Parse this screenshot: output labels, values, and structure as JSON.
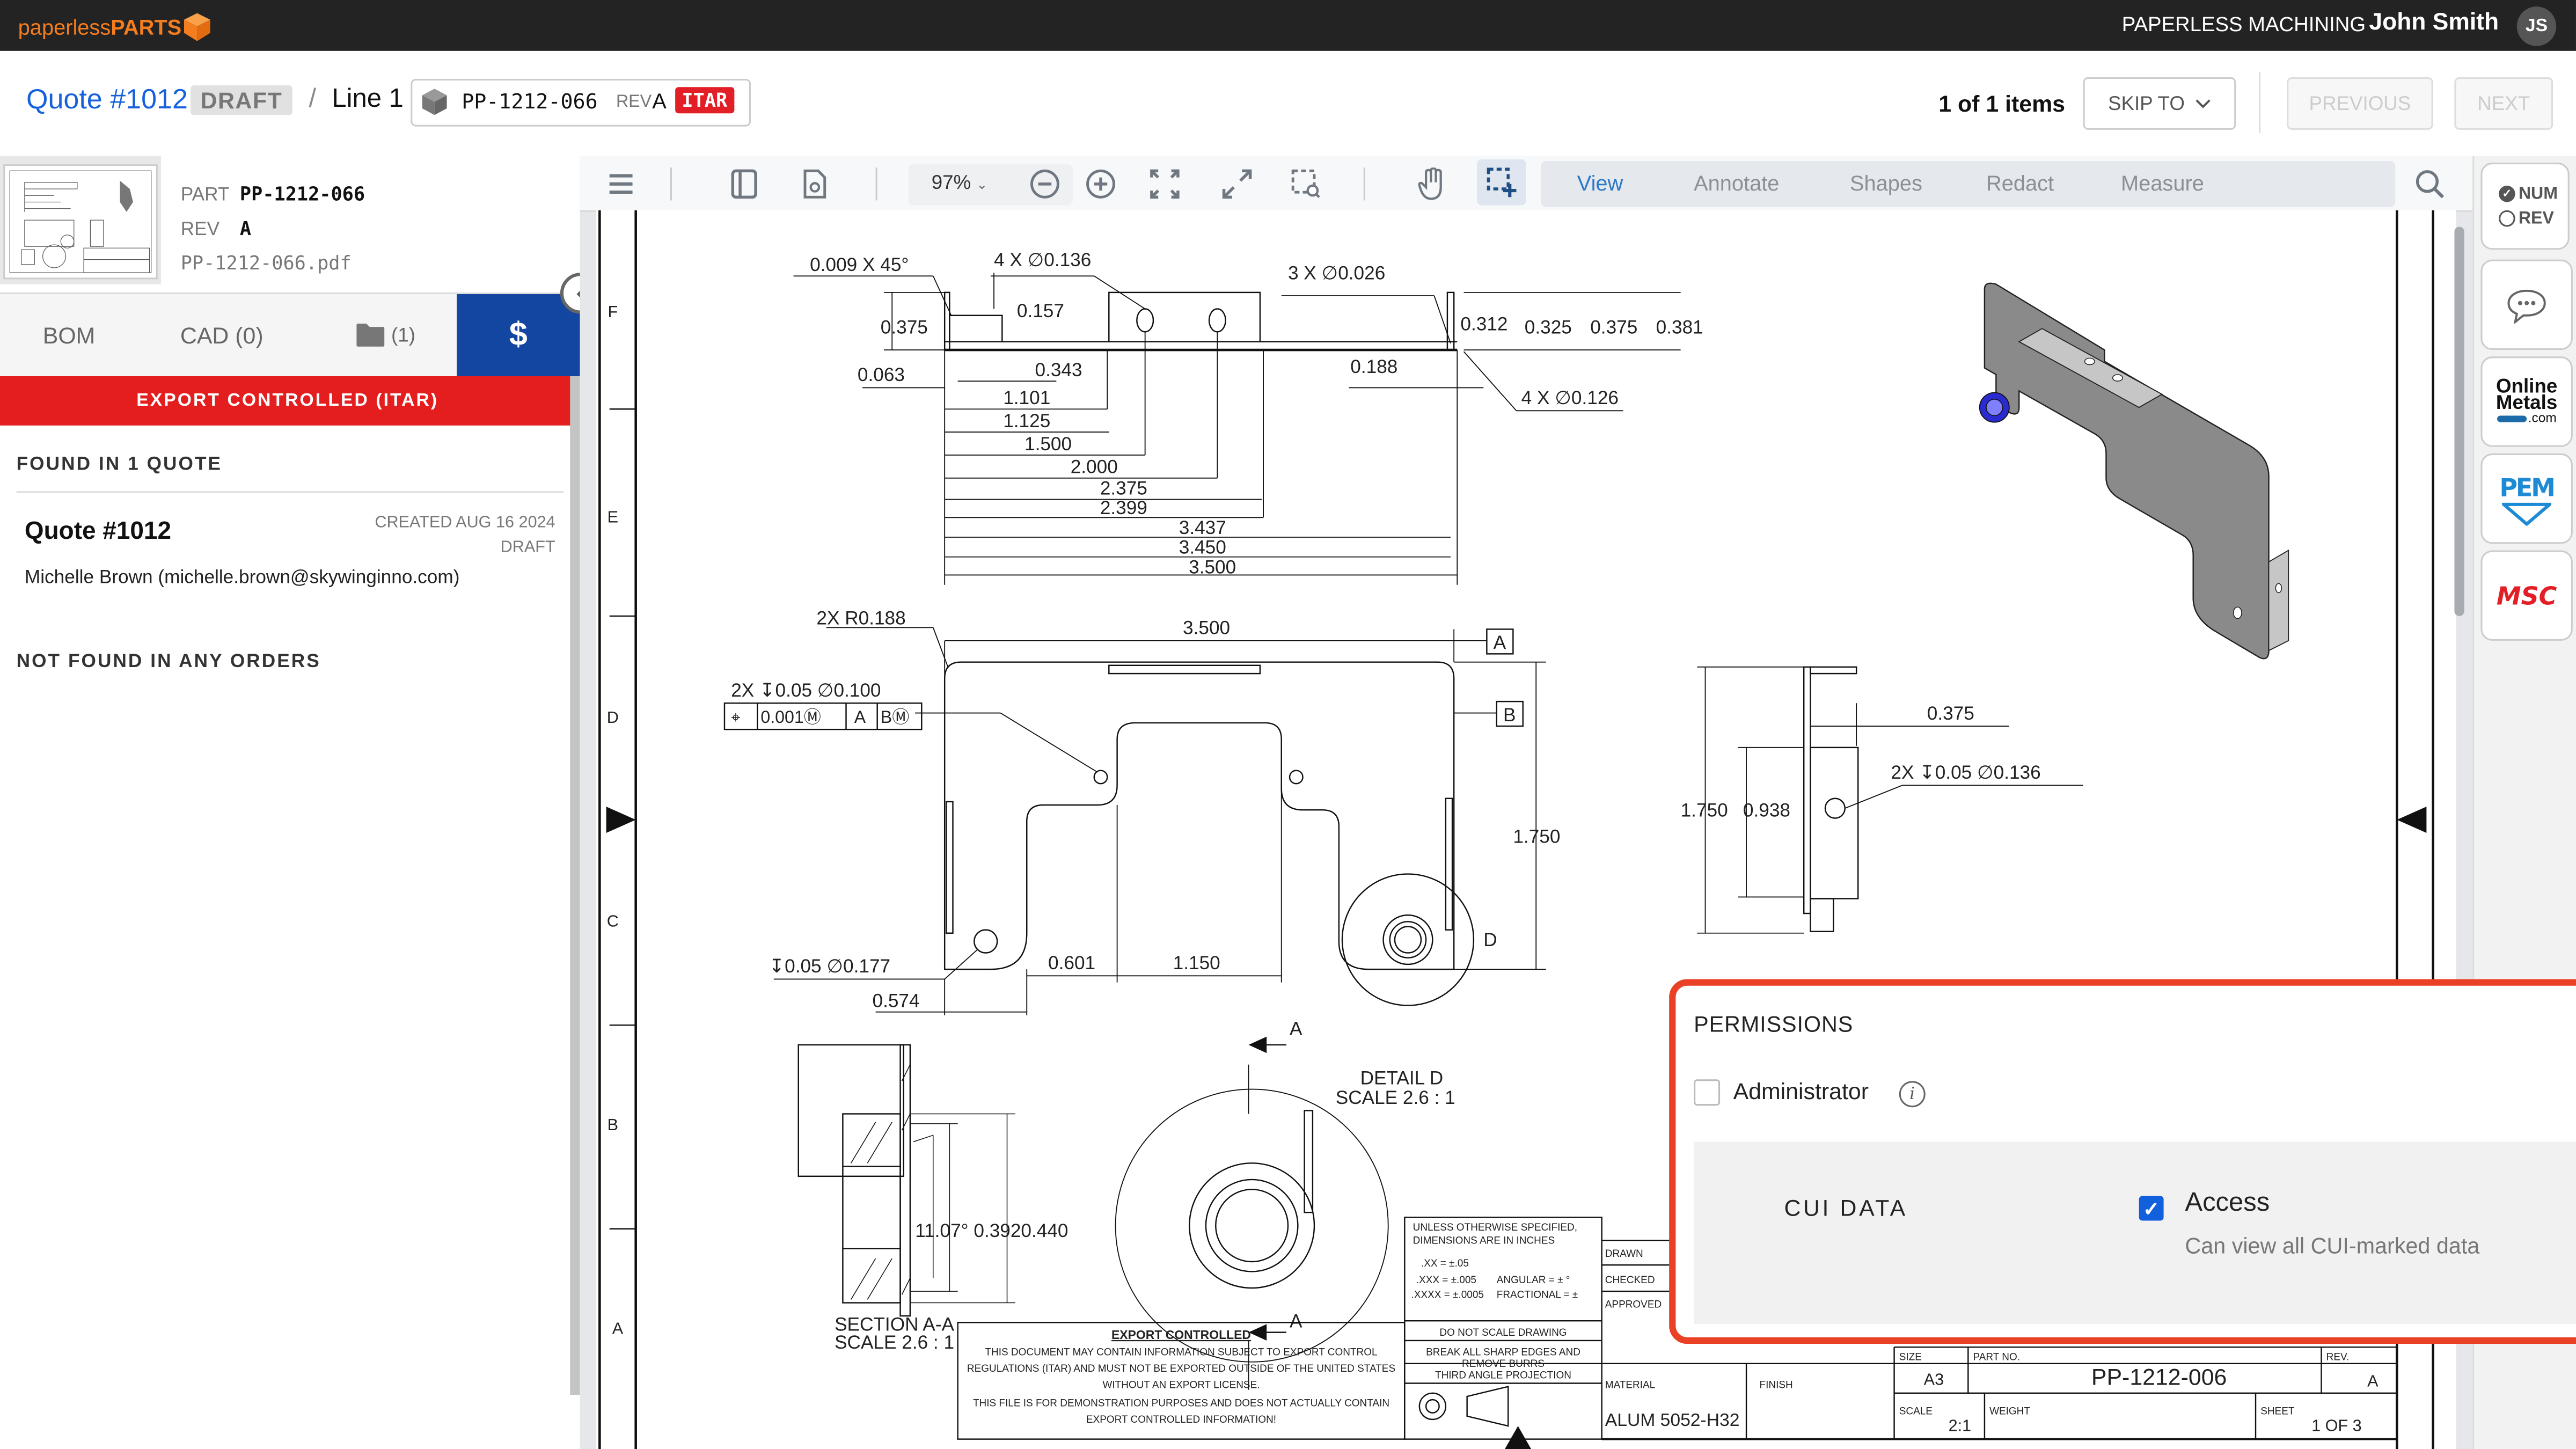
{
  "topbar": {
    "logo_light": "paperless",
    "logo_bold": "PARTS",
    "org": "PAPERLESS MACHINING",
    "user_name": "John Smith",
    "user_initials": "JS"
  },
  "header": {
    "quote_link": "Quote #1012",
    "quote_status": "DRAFT",
    "separator": "/",
    "line_label": "Line 1",
    "part_number": "PP-1212-066",
    "rev_label": "REV",
    "rev_value": "A",
    "itar_badge": "ITAR",
    "items_count": "1 of 1 items",
    "skip_to": "SKIP TO",
    "previous": "PREVIOUS",
    "next": "NEXT"
  },
  "left_panel": {
    "part_label": "PART",
    "part_value": "PP-1212-066",
    "rev_label": "REV",
    "rev_value": "A",
    "file_name": "PP-1212-066.pdf",
    "tabs": [
      {
        "label": "BOM"
      },
      {
        "label": "CAD (0)"
      },
      {
        "label": "(1)",
        "icon": "folder-icon"
      },
      {
        "label": "$",
        "icon": "dollar-icon",
        "active": true
      }
    ],
    "itar_banner": "EXPORT CONTROLLED (ITAR)",
    "found_title": "FOUND IN 1 QUOTE",
    "quote": {
      "title": "Quote #1012",
      "created": "CREATED AUG 16 2024",
      "status": "DRAFT",
      "contact": "Michelle Brown (michelle.brown@skywinginno.com)"
    },
    "orders_title": "NOT FOUND IN ANY ORDERS"
  },
  "toolbar": {
    "zoom_value": "97%",
    "modes": [
      {
        "label": "View",
        "active": true
      },
      {
        "label": "Annotate"
      },
      {
        "label": "Shapes"
      },
      {
        "label": "Redact"
      },
      {
        "label": "Measure"
      }
    ]
  },
  "right_rail": {
    "num_label": "NUM",
    "rev_label": "REV",
    "num_selected": true,
    "online_metals_1": "Online",
    "online_metals_2": "Metals",
    "online_metals_3": ".com",
    "pem": "PEM",
    "msc": "MSC"
  },
  "permissions": {
    "title": "PERMISSIONS",
    "administrator_label": "Administrator",
    "administrator_checked": false,
    "cui_label": "CUI DATA",
    "access_label": "Access",
    "access_checked": true,
    "access_desc": "Can view all CUI-marked data"
  },
  "drawing": {
    "zones": [
      "F",
      "E",
      "D",
      "C",
      "B",
      "A"
    ],
    "top_view": {
      "chamfer": "0.009 X 45°",
      "holes_a": "4 X ∅0.136",
      "holes_b": "3 X ∅0.026",
      "holes_c": "4 X ∅0.126",
      "d_0375": "0.375",
      "d_0157": "0.157",
      "d_0063": "0.063",
      "d_0343": "0.343",
      "d_0188": "0.188",
      "right_dims": [
        "0.312",
        "0.325",
        "0.375",
        "0.381"
      ],
      "chain": [
        "1.101",
        "1.125",
        "1.500",
        "2.000",
        "2.375",
        "2.399",
        "3.437",
        "3.450",
        "3.500"
      ]
    },
    "front_view": {
      "radius": "2X R0.188",
      "width": "3.500",
      "datum_a": "A",
      "datum_b": "B",
      "hole_callout": "2X ↧0.05 ∅0.100",
      "fcf": [
        "⌖",
        "0.001Ⓜ",
        "A",
        "BⓂ"
      ],
      "height": "1.750",
      "hole2": "↧0.05 ∅0.177",
      "d_0601": "0.601",
      "d_1150": "1.150",
      "d_0574": "0.574",
      "detail_marker": "D"
    },
    "side_view": {
      "d_0375": "0.375",
      "hole": "2X ↧0.05 ∅0.136",
      "d_1750": "1.750",
      "d_0938": "0.938"
    },
    "section": {
      "dims": "11.07° 0.3920.440",
      "title1": "SECTION A-A",
      "title2": "SCALE 2.6 : 1",
      "cut_label": "A"
    },
    "detail": {
      "title1": "DETAIL D",
      "title2": "SCALE 2.6 : 1"
    },
    "title_block": {
      "tol1": "UNLESS OTHERWISE SPECIFIED,",
      "tol2": "DIMENSIONS ARE IN INCHES",
      "tol3": ".XX = ±.05",
      "tol4": ".XXX = ±.005",
      "tol5": ".XXXX = ±.0005",
      "tol6": "ANGULAR = ± °",
      "tol7": "FRACTIONAL = ±",
      "drawn": "DRAWN",
      "checked": "CHECKED",
      "approved": "APPROVED",
      "noscale": "DO NOT SCALE DRAWING",
      "edges1": "BREAK ALL SHARP EDGES AND",
      "edges2": "REMOVE BURRS",
      "projection": "THIRD ANGLE PROJECTION",
      "export_title": "EXPORT CONTROLLED",
      "export_1": "THIS DOCUMENT MAY CONTAIN INFORMATION SUBJECT TO EXPORT CONTROL",
      "export_2": "REGULATIONS (ITAR) AND MUST NOT BE EXPORTED OUTSIDE OF THE UNITED STATES",
      "export_3": "WITHOUT AN EXPORT LICENSE.",
      "export_4": "THIS FILE IS FOR DEMONSTRATION PURPOSES AND DOES NOT ACTUALLY CONTAIN",
      "export_5": "EXPORT CONTROLLED INFORMATION!",
      "material_label": "MATERIAL",
      "material": "ALUM 5052-H32",
      "finish_label": "FINISH",
      "size_label": "SIZE",
      "size": "A3",
      "partno_label": "PART NO.",
      "partno": "PP-1212-006",
      "rev_label": "REV.",
      "rev": "A",
      "scale_label": "SCALE",
      "scale": "2:1",
      "weight_label": "WEIGHT",
      "sheet_label": "SHEET",
      "sheet": "1 OF 3"
    }
  }
}
